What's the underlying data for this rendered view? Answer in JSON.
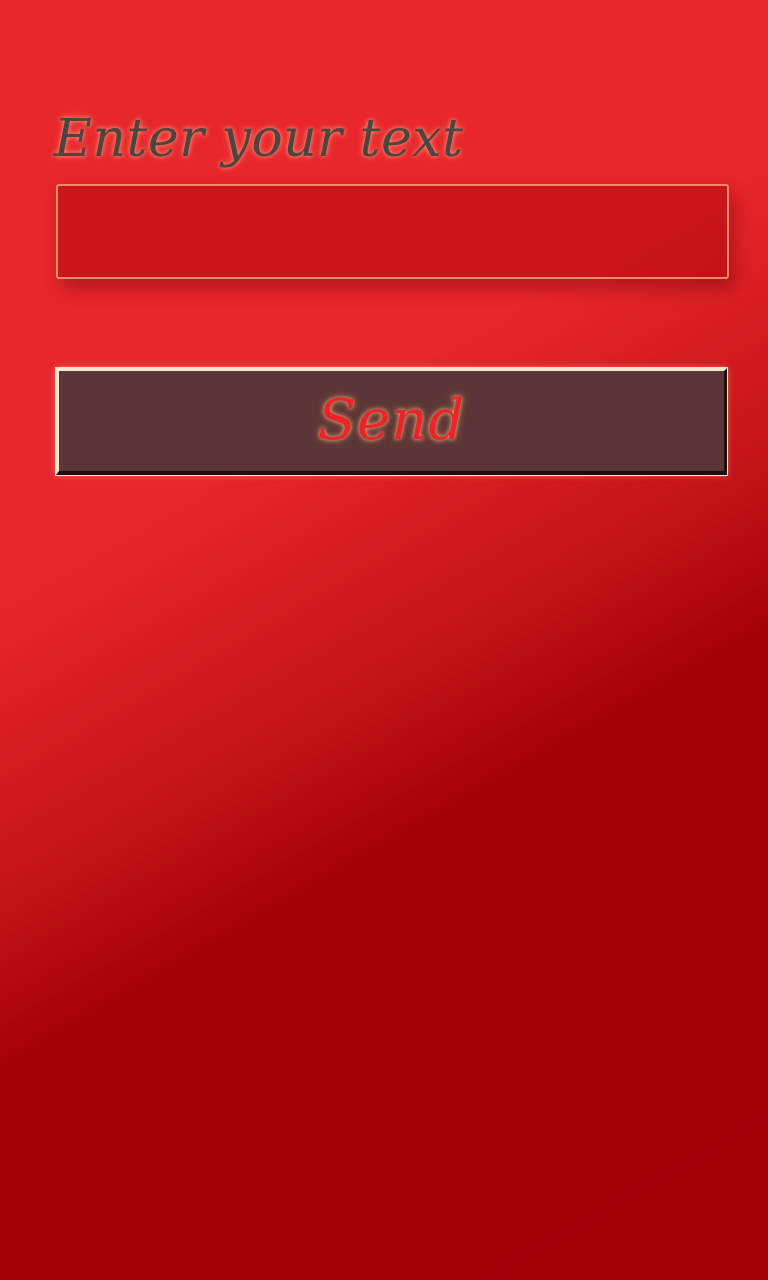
{
  "form": {
    "label": "Enter your text",
    "input_value": "",
    "input_placeholder": ""
  },
  "actions": {
    "send_label": "Send"
  },
  "colors": {
    "background_light": "#e8262c",
    "background_dark": "#a10005",
    "label_text": "#4e4440",
    "input_border": "#f08a66",
    "button_fill": "#5c3636",
    "button_text": "#ec2328"
  }
}
